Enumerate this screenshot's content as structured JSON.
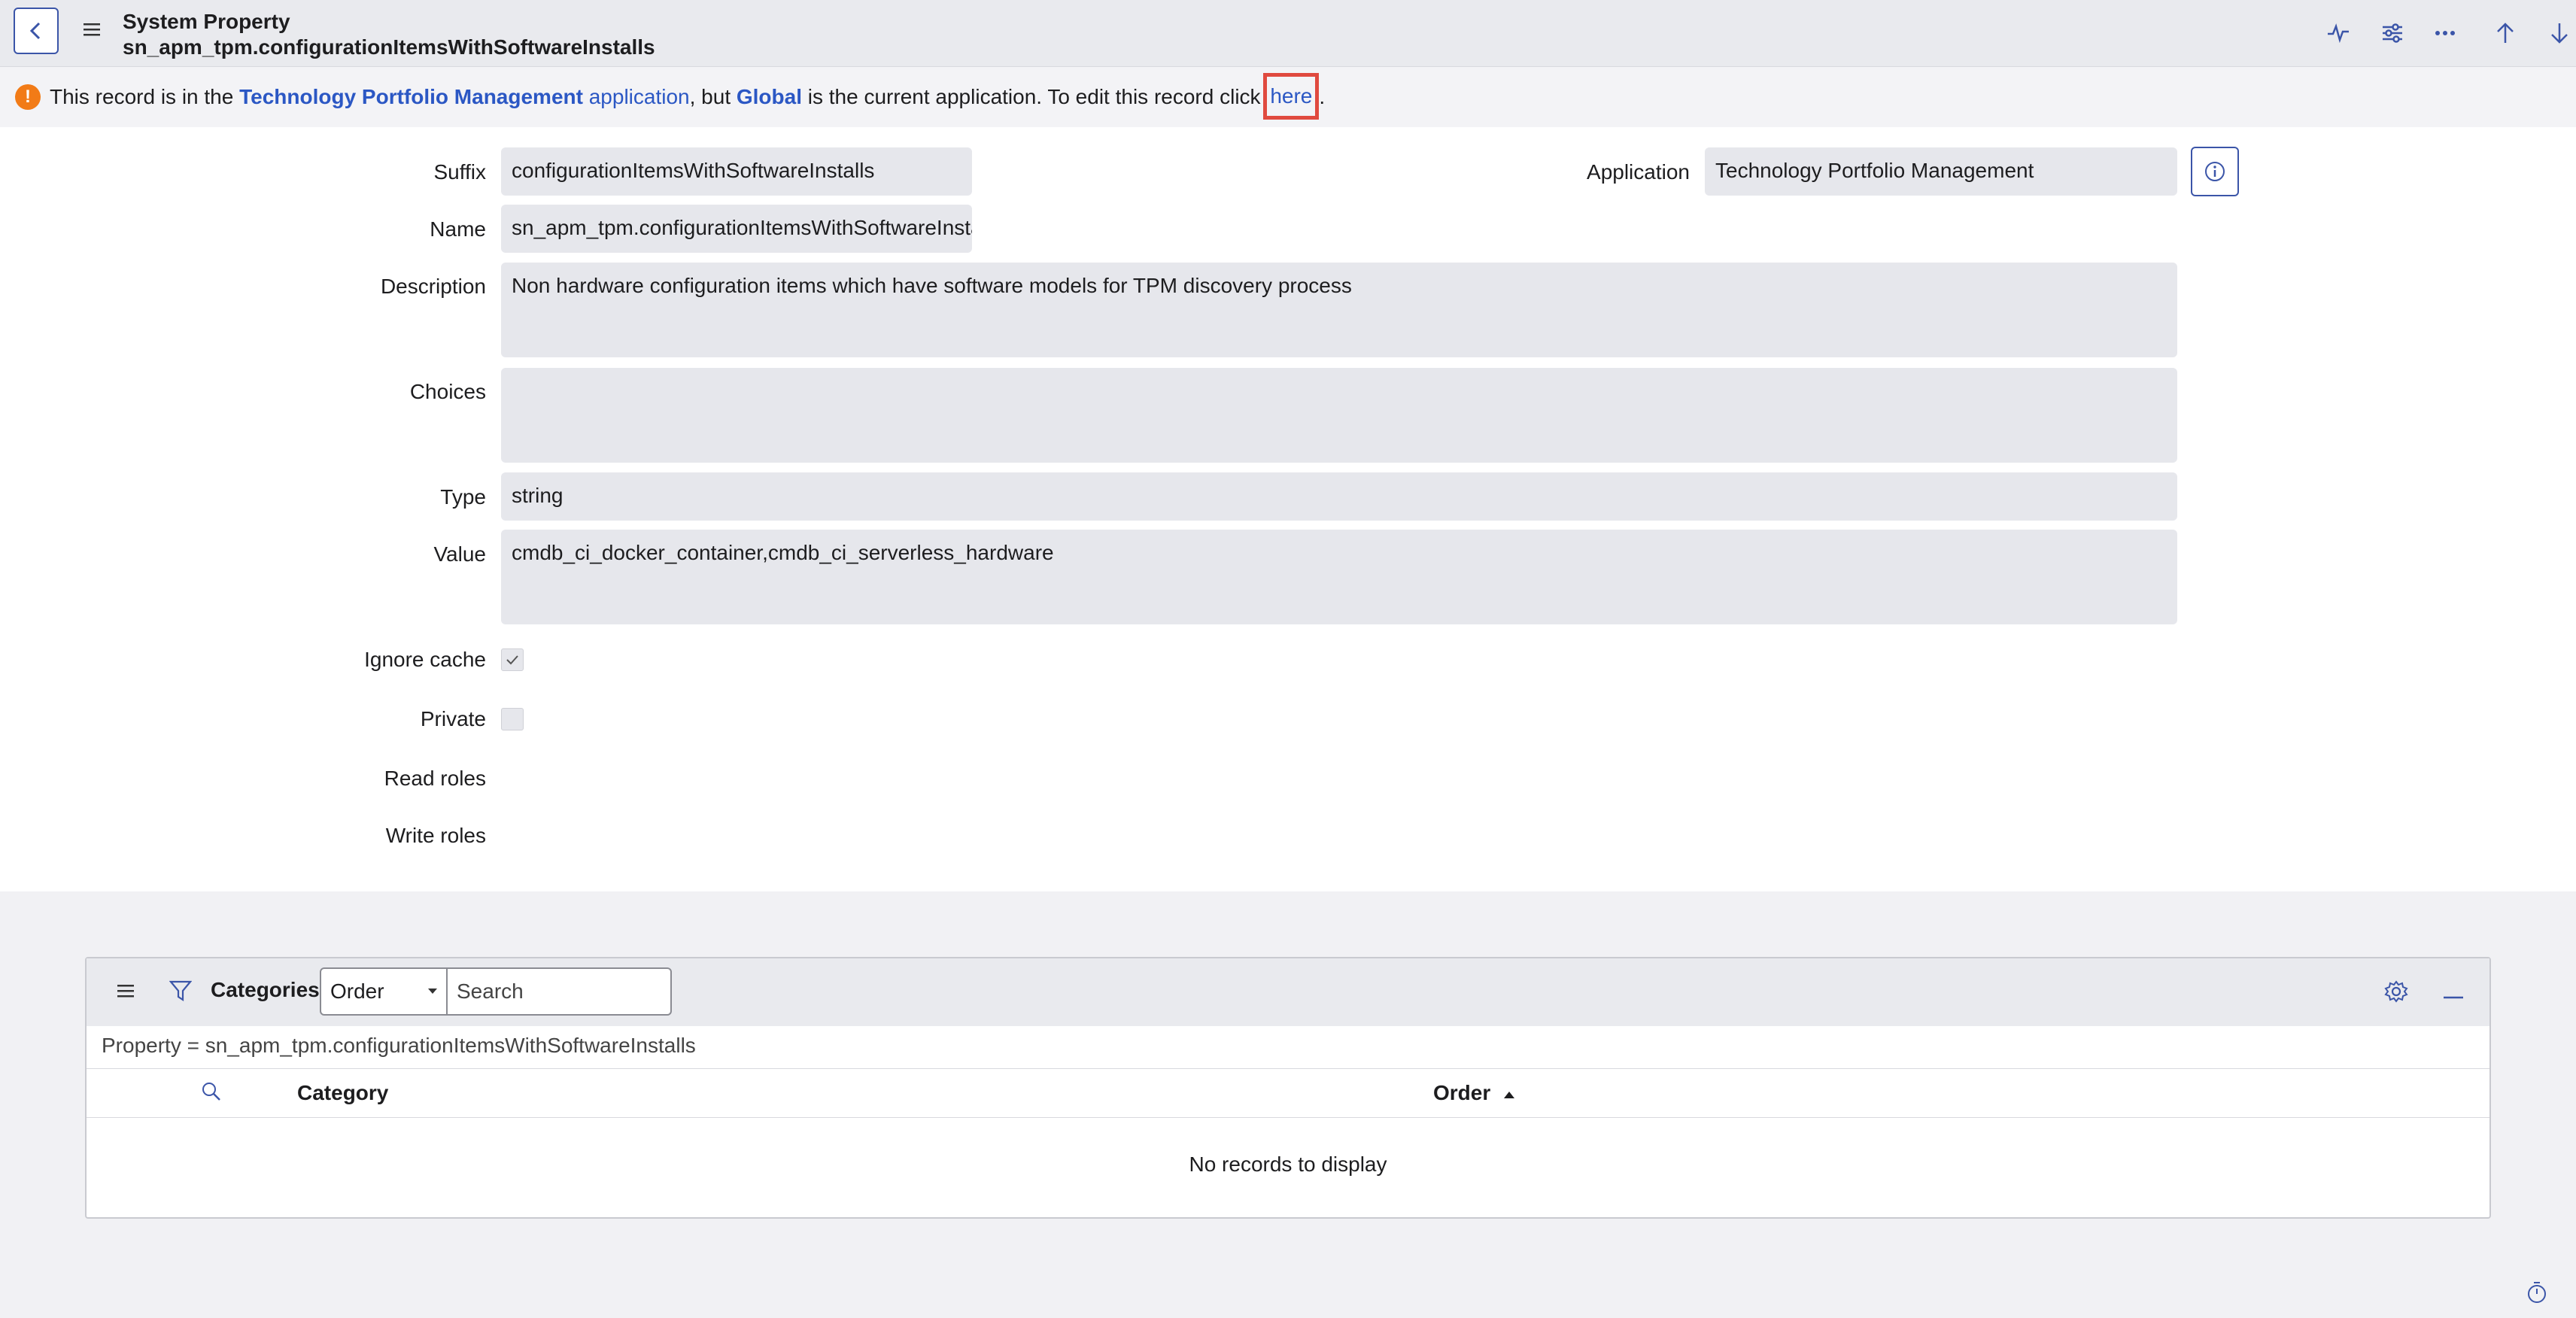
{
  "header": {
    "title": "System Property",
    "subtitle": "sn_apm_tpm.configurationItemsWithSoftwareInstalls",
    "icons": [
      "back-icon",
      "hamburger-icon",
      "activity-icon",
      "sliders-icon",
      "more-icon",
      "arrow-up-icon",
      "arrow-down-icon"
    ]
  },
  "banner": {
    "part1": "This record is in the ",
    "app_link": "Technology Portfolio Management",
    "app_word": "application",
    "part2": ", but ",
    "global_link": "Global",
    "part3": " is the current application. To edit this record click ",
    "here_link": "here",
    "period": "."
  },
  "form": {
    "suffix_label": "Suffix",
    "suffix_value": "configurationItemsWithSoftwareInstalls",
    "application_label": "Application",
    "application_value": "Technology Portfolio Management",
    "name_label": "Name",
    "name_value": "sn_apm_tpm.configurationItemsWithSoftwareInstalls",
    "description_label": "Description",
    "description_value": "Non hardware configuration items which have software models for TPM discovery process",
    "choices_label": "Choices",
    "choices_value": "",
    "type_label": "Type",
    "type_value": "string",
    "value_label": "Value",
    "value_value": "cmdb_ci_docker_container,cmdb_ci_serverless_hardware",
    "ignore_cache_label": "Ignore cache",
    "ignore_cache_checked": true,
    "private_label": "Private",
    "private_checked": false,
    "read_roles_label": "Read roles",
    "write_roles_label": "Write roles"
  },
  "related_list": {
    "title": "Categories",
    "select_value": "Order",
    "search_placeholder": "Search",
    "filter": "Property = sn_apm_tpm.configurationItemsWithSoftwareInstalls",
    "col_category": "Category",
    "col_order": "Order",
    "empty": "No records to display"
  },
  "colors": {
    "link": "#2b57c4",
    "warning": "#f27b17",
    "highlight": "#e04a3f",
    "accent": "#3b55a8"
  }
}
